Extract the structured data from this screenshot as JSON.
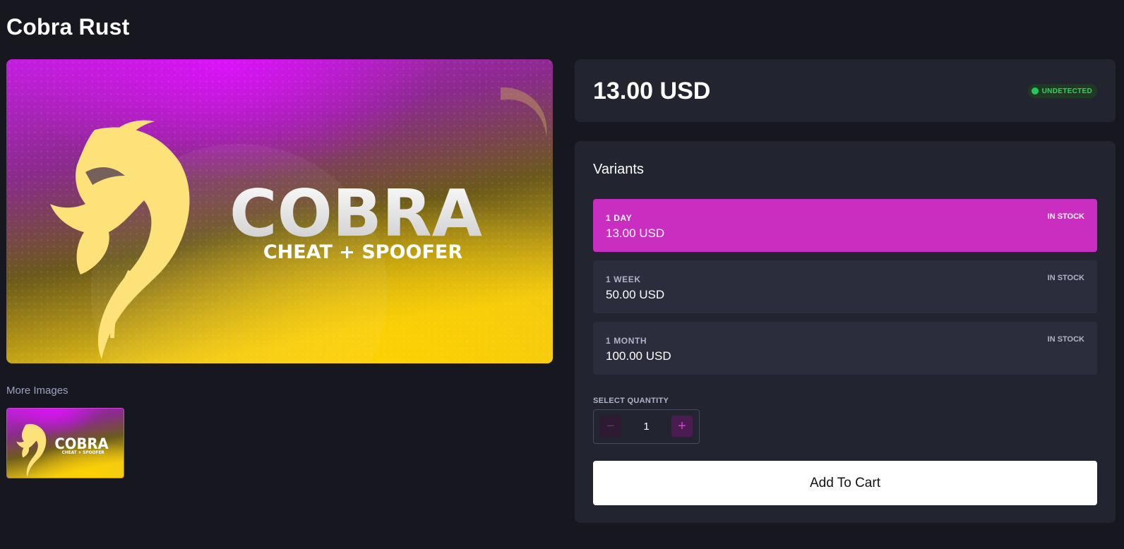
{
  "product": {
    "title": "Cobra Rust",
    "price": "13.00 USD",
    "status": "UNDETECTED"
  },
  "hero": {
    "logo_text": "COBRA",
    "logo_subtext": "CHEAT + SPOOFER"
  },
  "gallery": {
    "more_label": "More Images"
  },
  "variants": {
    "heading": "Variants",
    "items": [
      {
        "name": "1 DAY",
        "price": "13.00 USD",
        "stock": "IN STOCK",
        "selected": true
      },
      {
        "name": "1 WEEK",
        "price": "50.00 USD",
        "stock": "IN STOCK",
        "selected": false
      },
      {
        "name": "1 MONTH",
        "price": "100.00 USD",
        "stock": "IN STOCK",
        "selected": false
      }
    ]
  },
  "quantity": {
    "label": "SELECT QUANTITY",
    "value": "1",
    "minus_symbol": "−",
    "plus_symbol": "+"
  },
  "cart": {
    "button_label": "Add To Cart"
  },
  "colors": {
    "accent": "#ca2ec0",
    "status_green": "#22c55e",
    "background": "#16171f",
    "card": "#222430"
  }
}
